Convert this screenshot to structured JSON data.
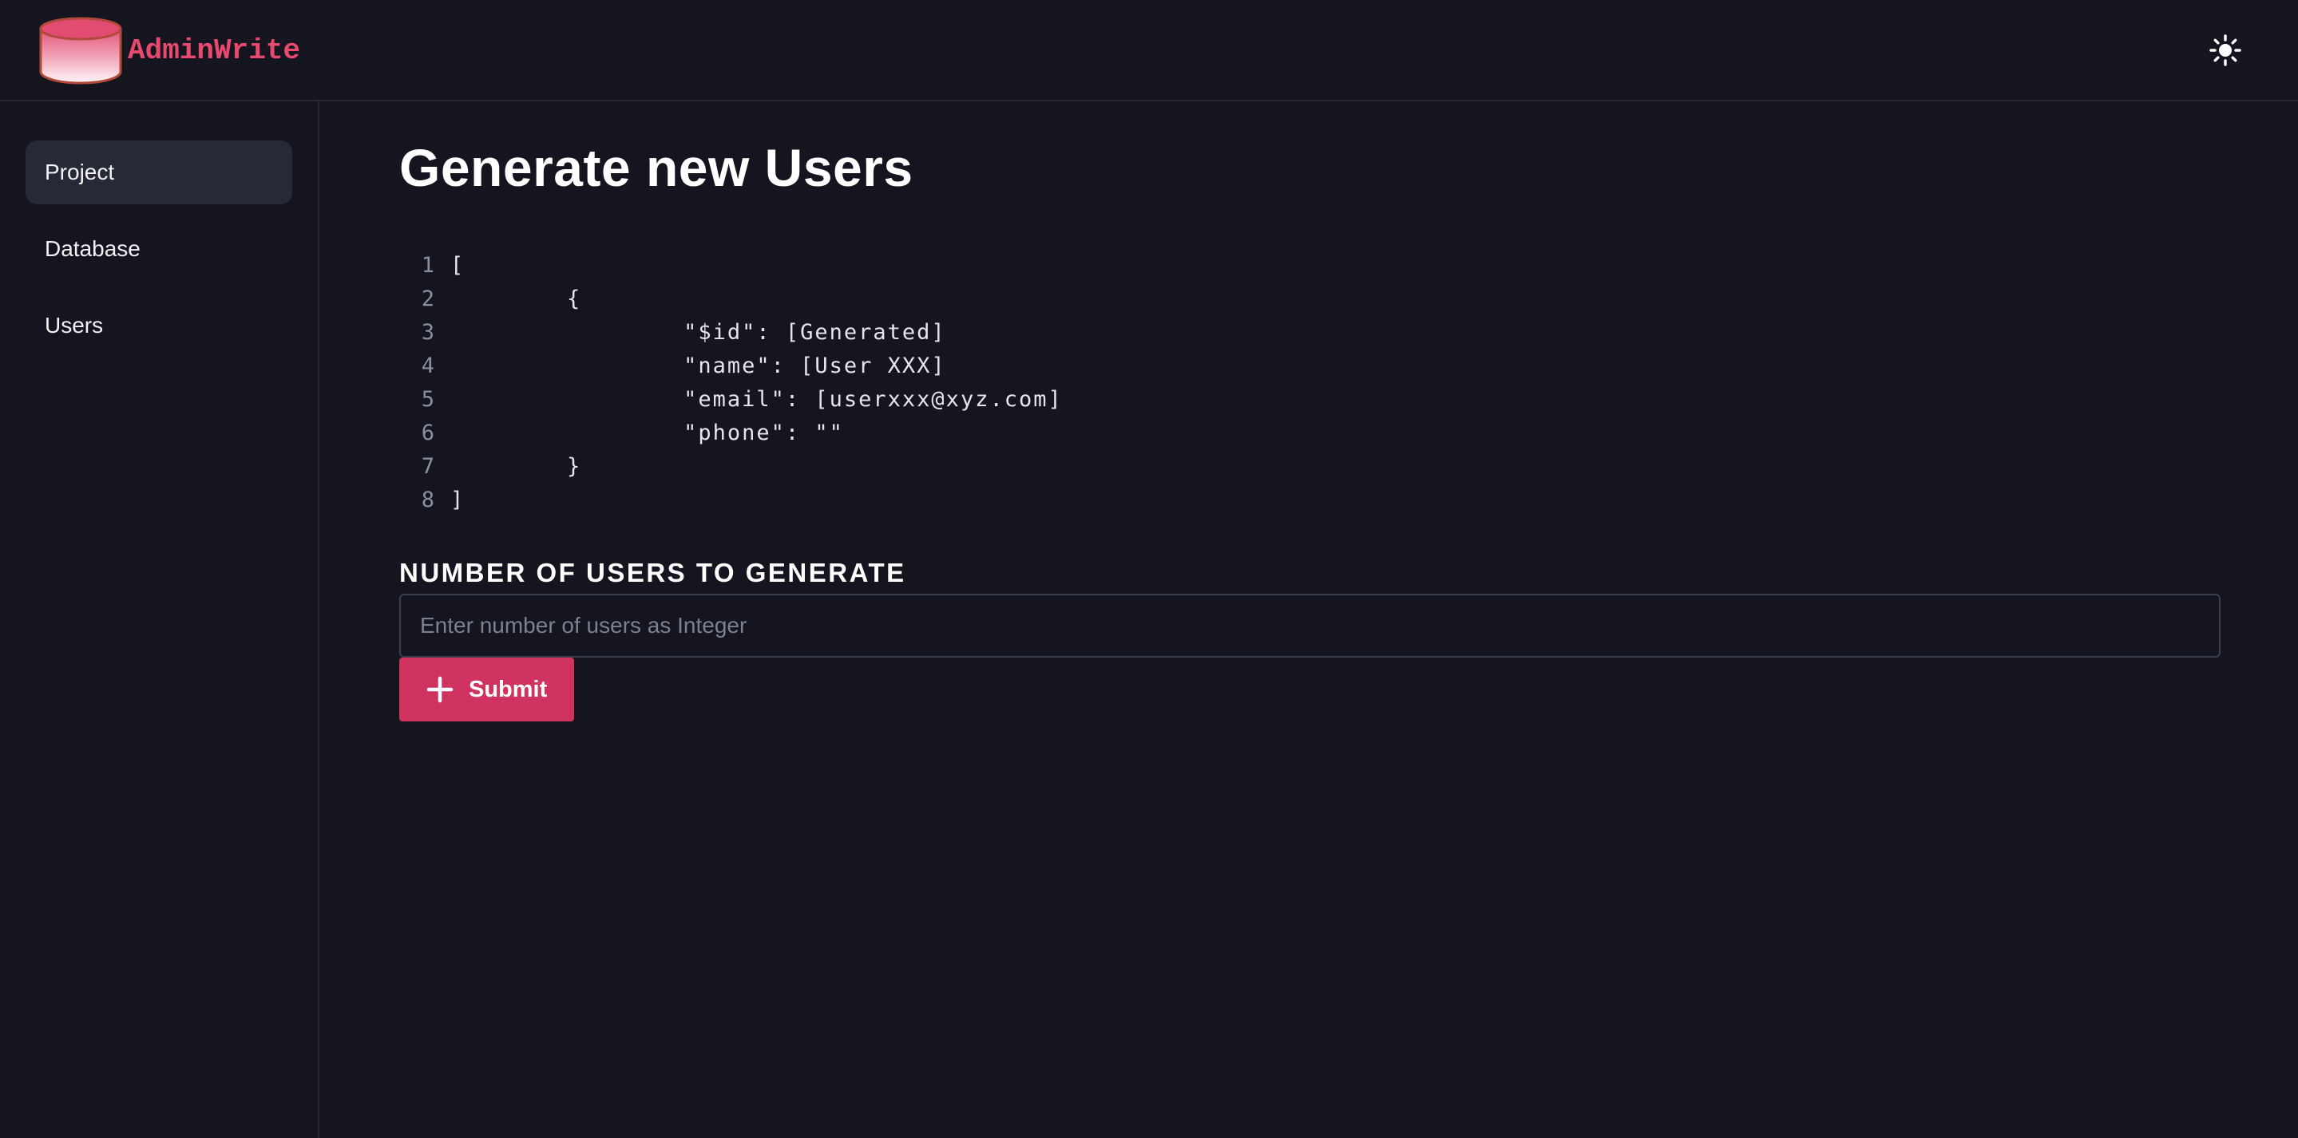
{
  "app": {
    "name": "AdminWrite",
    "brand_color": "#e8496f",
    "logo_icon": "database-cylinder-icon"
  },
  "header": {
    "theme_toggle_icon": "sun-icon"
  },
  "sidebar": {
    "items": [
      {
        "label": "Project",
        "active": true
      },
      {
        "label": "Database",
        "active": false
      },
      {
        "label": "Users",
        "active": false
      }
    ]
  },
  "main": {
    "title": "Generate new Users",
    "code_preview": {
      "lines": [
        {
          "no": "1",
          "text": "["
        },
        {
          "no": "2",
          "text": "        {"
        },
        {
          "no": "3",
          "text": "                \"$id\": [Generated]"
        },
        {
          "no": "4",
          "text": "                \"name\": [User XXX]"
        },
        {
          "no": "5",
          "text": "                \"email\": [userxxx@xyz.com]"
        },
        {
          "no": "6",
          "text": "                \"phone\": \"\""
        },
        {
          "no": "7",
          "text": "        }"
        },
        {
          "no": "8",
          "text": "]"
        }
      ]
    },
    "form": {
      "label": "NUMBER OF USERS TO GENERATE",
      "input_value": "",
      "input_placeholder": "Enter number of users as Integer",
      "submit_label": "Submit",
      "submit_icon": "plus-icon",
      "submit_color": "#d0335f"
    }
  }
}
